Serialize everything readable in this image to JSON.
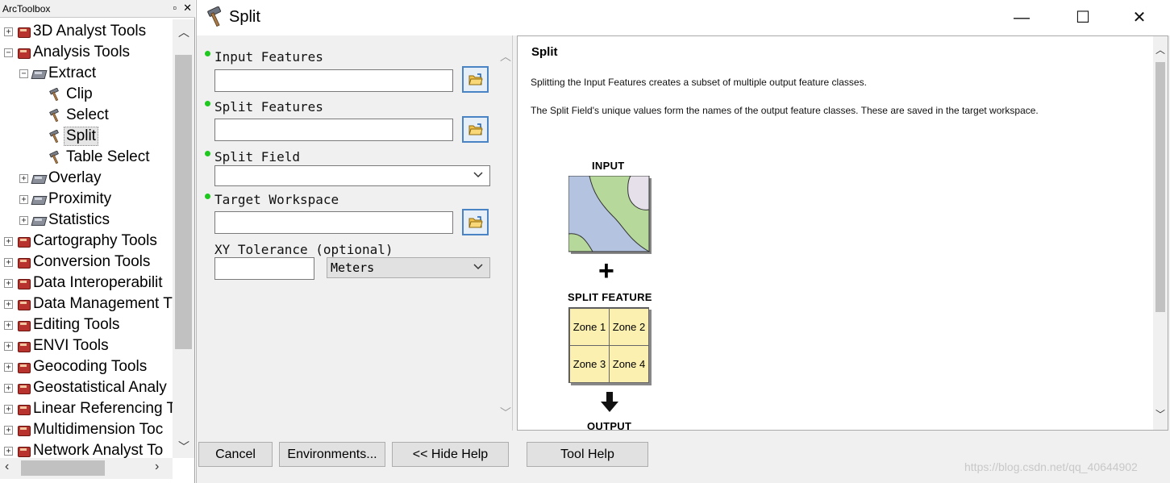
{
  "toolbox": {
    "title": "ArcToolbox",
    "items": [
      {
        "label": "3D Analyst Tools",
        "kind": "toolbox",
        "expander": "+"
      },
      {
        "label": "Analysis Tools",
        "kind": "toolbox",
        "expander": "−"
      },
      {
        "label": "Extract",
        "kind": "toolset",
        "expander": "−"
      },
      {
        "label": "Clip",
        "kind": "tool"
      },
      {
        "label": "Select",
        "kind": "tool"
      },
      {
        "label": "Split",
        "kind": "tool",
        "selected": true
      },
      {
        "label": "Table Select",
        "kind": "tool"
      },
      {
        "label": "Overlay",
        "kind": "toolset",
        "expander": "+"
      },
      {
        "label": "Proximity",
        "kind": "toolset",
        "expander": "+"
      },
      {
        "label": "Statistics",
        "kind": "toolset",
        "expander": "+"
      },
      {
        "label": "Cartography Tools",
        "kind": "toolbox",
        "expander": "+"
      },
      {
        "label": "Conversion Tools",
        "kind": "toolbox",
        "expander": "+"
      },
      {
        "label": "Data Interoperabilit",
        "kind": "toolbox",
        "expander": "+"
      },
      {
        "label": "Data Management T",
        "kind": "toolbox",
        "expander": "+"
      },
      {
        "label": "Editing Tools",
        "kind": "toolbox",
        "expander": "+"
      },
      {
        "label": "ENVI Tools",
        "kind": "toolbox",
        "expander": "+"
      },
      {
        "label": "Geocoding Tools",
        "kind": "toolbox",
        "expander": "+"
      },
      {
        "label": "Geostatistical Analy",
        "kind": "toolbox",
        "expander": "+"
      },
      {
        "label": "Linear Referencing T",
        "kind": "toolbox",
        "expander": "+"
      },
      {
        "label": "Multidimension Toc",
        "kind": "toolbox",
        "expander": "+"
      },
      {
        "label": "Network Analyst To",
        "kind": "toolbox",
        "expander": "+"
      }
    ]
  },
  "dialog": {
    "title": "Split",
    "params": {
      "input_features": {
        "label": "Input Features",
        "value": ""
      },
      "split_features": {
        "label": "Split Features",
        "value": ""
      },
      "split_field": {
        "label": "Split Field",
        "value": ""
      },
      "target_workspace": {
        "label": "Target Workspace",
        "value": ""
      },
      "xy_tolerance": {
        "label": "XY Tolerance (optional)",
        "value": "",
        "unit": "Meters"
      }
    },
    "help": {
      "title": "Split",
      "para1": "Splitting the Input Features creates a subset of multiple output feature classes.",
      "para2": "The Split Field's unique values form the names of the output feature classes. These are saved in the target workspace.",
      "diagram": {
        "input_label": "INPUT",
        "plus": "+",
        "split_label": "SPLIT FEATURE",
        "zones": [
          "Zone 1",
          "Zone 2",
          "Zone 3",
          "Zone 4"
        ],
        "output_label": "OUTPUT"
      }
    },
    "buttons": {
      "cancel": "Cancel",
      "environments": "Environments...",
      "hide_help": "<< Hide Help",
      "tool_help": "Tool Help"
    }
  },
  "watermark": "https://blog.csdn.net/qq_40644902",
  "colors": {
    "required_dot": "#1ec81e",
    "browse_border": "#4b84c4",
    "zone_fill": "#fbf0b0",
    "toolbox_red": "#b8332e"
  }
}
